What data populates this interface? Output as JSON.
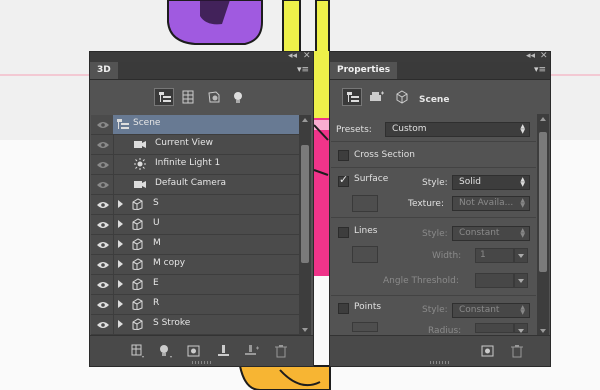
{
  "panel_3d": {
    "tab": "3D",
    "collapse_glyph": "◂◂",
    "close_glyph": "✕",
    "menu_glyph": "▾≡",
    "layers": [
      {
        "label": "Scene",
        "selected": true,
        "indent": false,
        "expand": false
      },
      {
        "label": "Current View",
        "selected": false,
        "indent": true,
        "expand": false
      },
      {
        "label": "Infinite Light 1",
        "selected": false,
        "indent": true,
        "expand": false
      },
      {
        "label": "Default Camera",
        "selected": false,
        "indent": true,
        "expand": false
      },
      {
        "label": "S",
        "selected": false,
        "indent": false,
        "expand": true
      },
      {
        "label": "U",
        "selected": false,
        "indent": false,
        "expand": true
      },
      {
        "label": "M",
        "selected": false,
        "indent": false,
        "expand": true
      },
      {
        "label": "M copy",
        "selected": false,
        "indent": false,
        "expand": true
      },
      {
        "label": "E",
        "selected": false,
        "indent": false,
        "expand": true
      },
      {
        "label": "R",
        "selected": false,
        "indent": false,
        "expand": true
      },
      {
        "label": "S Stroke",
        "selected": false,
        "indent": false,
        "expand": true
      }
    ]
  },
  "panel_properties": {
    "tab": "Properties",
    "collapse_glyph": "◂◂",
    "close_glyph": "✕",
    "menu_glyph": "▾≡",
    "title": "Scene",
    "presets_label": "Presets:",
    "presets_value": "Custom",
    "cross_section": "Cross Section",
    "surface": {
      "label": "Surface",
      "style_label": "Style:",
      "style_value": "Solid",
      "texture_label": "Texture:",
      "texture_value": "Not Availa..."
    },
    "lines": {
      "label": "Lines",
      "style_label": "Style:",
      "style_value": "Constant",
      "width_label": "Width:",
      "width_value": "1",
      "angle_label": "Angle Threshold:"
    },
    "points": {
      "label": "Points",
      "style_label": "Style:",
      "style_value": "Constant",
      "radius_label": "Radius:"
    }
  },
  "colors": {
    "panel": "#535353",
    "selection": "#687a93",
    "art_purple": "#a05ae0",
    "art_yellow": "#eef04a",
    "art_pink": "#f0348a",
    "art_orange": "#f7b533"
  }
}
